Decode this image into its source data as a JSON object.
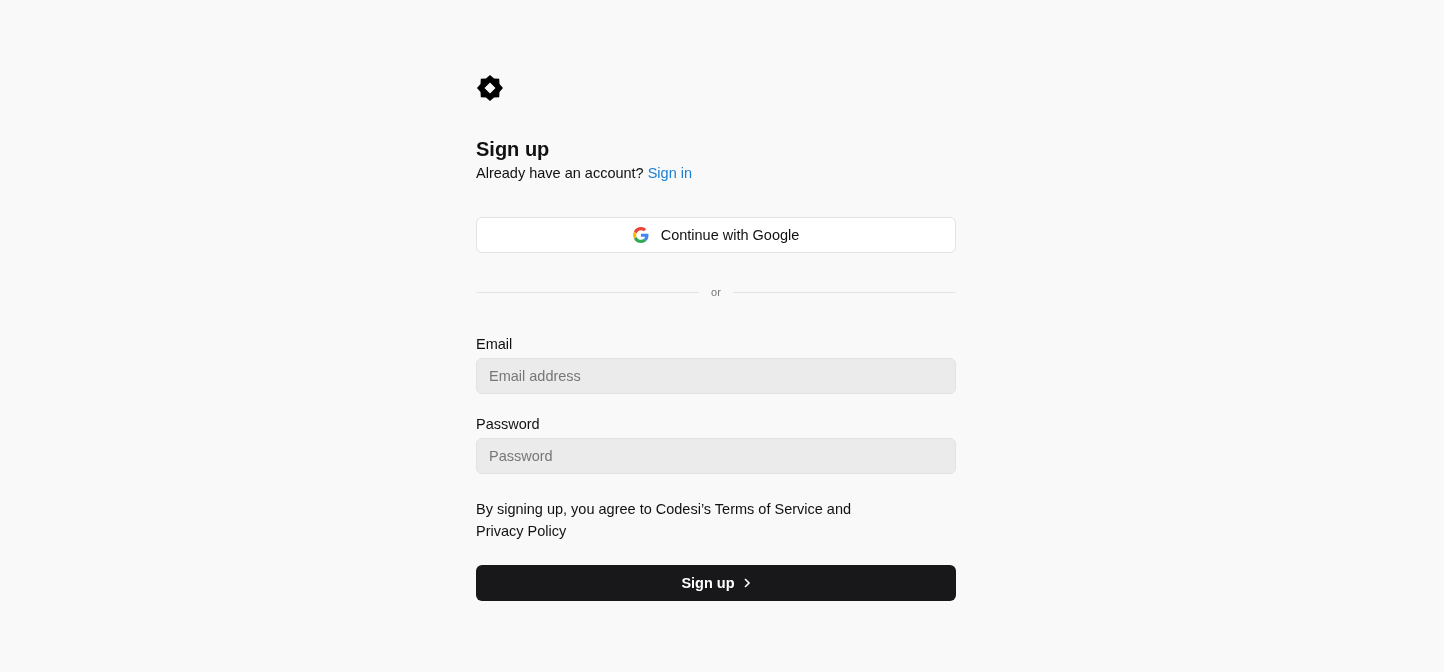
{
  "title": "Sign up",
  "subtitle": {
    "text": "Already have an account?",
    "link": "Sign in"
  },
  "oauth_button": "Continue with Google",
  "divider": "or",
  "fields": [
    {
      "label": "Email",
      "placeholder": "Email address"
    },
    {
      "label": "Password",
      "placeholder": "Password"
    }
  ],
  "terms": "By signing up, you agree to Codesi’s Terms of Service and Privacy Policy",
  "submit_button": "Sign up"
}
